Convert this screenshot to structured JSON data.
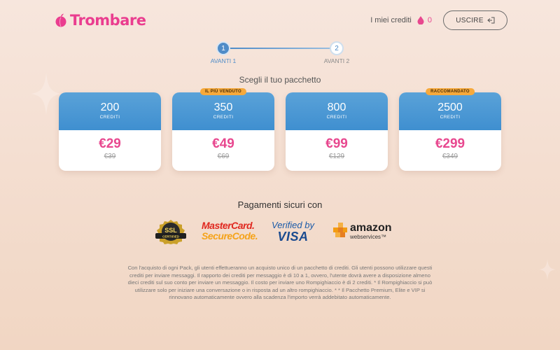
{
  "brand": {
    "name": "Trombare"
  },
  "header": {
    "credits_label": "I miei crediti",
    "credits_count": "0",
    "logout_label": "USCIRE"
  },
  "stepper": {
    "steps": [
      {
        "number": "1",
        "label": "AVANTI 1"
      },
      {
        "number": "2",
        "label": "AVANTI 2"
      }
    ]
  },
  "section_title": "Scegli il tuo pacchetto",
  "packages": [
    {
      "amount": "200",
      "unit": "CREDITI",
      "price": "€29",
      "old_price": "€39",
      "badge": ""
    },
    {
      "amount": "350",
      "unit": "CREDITI",
      "price": "€49",
      "old_price": "€69",
      "badge": "IL PIÙ VENDUTO"
    },
    {
      "amount": "800",
      "unit": "CREDITI",
      "price": "€99",
      "old_price": "€129",
      "badge": ""
    },
    {
      "amount": "2500",
      "unit": "CREDITI",
      "price": "€299",
      "old_price": "€349",
      "badge": "RACCOMANDATO"
    }
  ],
  "payments": {
    "title": "Pagamenti sicuri con",
    "ssl": "SSL",
    "ssl_sub": "CERTIFIED",
    "mastercard_line1": "MasterCard.",
    "mastercard_line2": "SecureCode.",
    "visa_line1": "Verified by",
    "visa_line2": "VISA",
    "amazon_line1": "amazon",
    "amazon_line2": "webservices™"
  },
  "disclaimer": "Con l'acquisto di ogni Pack, gli utenti effettueranno un acquisto unico di un pacchetto di crediti. Gli utenti possono utilizzare questi crediti per inviare messaggi. Il rapporto dei crediti per messaggio è di 10 a 1, ovvero, l'utente dovrà avere a disposizione almeno dieci crediti sul suo conto per inviare un messaggio. Il costo per inviare uno Rompighiaccio è di 2 crediti. * Il Rompighiaccio si può utilizzare solo per iniziare una conversazione o in risposta ad un altro rompighiaccio. * * Il Pacchetto Premium, Elite e VIP si rinnovano automaticamente ovvero alla scadenza l'importo verrà addebitato automaticamente."
}
